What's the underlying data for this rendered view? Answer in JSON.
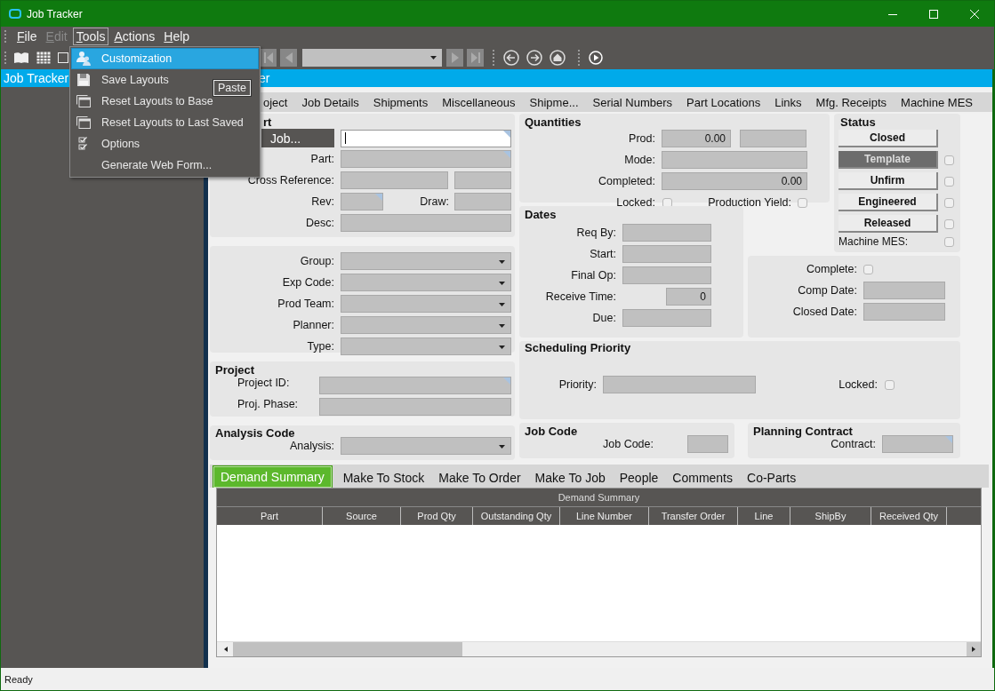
{
  "window": {
    "title": "Job Tracker"
  },
  "menu_bar": [
    {
      "label": "File",
      "disabled": false,
      "selected": false
    },
    {
      "label": "Edit",
      "disabled": true,
      "selected": false
    },
    {
      "label": "Tools",
      "disabled": false,
      "selected": true
    },
    {
      "label": "Actions",
      "disabled": false,
      "selected": false
    },
    {
      "label": "Help",
      "disabled": false,
      "selected": false
    }
  ],
  "open_menu": [
    {
      "label": "Customization",
      "kind": "users",
      "selected": true
    },
    {
      "label": "Save Layouts",
      "kind": "floppy",
      "selected": false
    },
    {
      "label": "Reset Layouts to Base",
      "kind": "window",
      "selected": false
    },
    {
      "label": "Reset Layouts to Last Saved",
      "kind": "window",
      "selected": false
    },
    {
      "label": "Options",
      "kind": "checklist",
      "selected": false
    },
    {
      "label": "Generate Web Form...",
      "kind": "none",
      "selected": false
    }
  ],
  "tooltip": "Paste",
  "left_panel": {
    "title": "Job Tracker"
  },
  "main_header": {
    "title": "er"
  },
  "tabs": [
    {
      "label": "oject",
      "selected": false
    },
    {
      "label": "Job Details",
      "selected": false
    },
    {
      "label": "Shipments",
      "selected": false
    },
    {
      "label": "Miscellaneous",
      "selected": false
    },
    {
      "label": "Shipme...",
      "selected": false
    },
    {
      "label": "Serial Numbers",
      "selected": false
    },
    {
      "label": "Part Locations",
      "selected": false
    },
    {
      "label": "Links",
      "selected": false
    },
    {
      "label": "Mfg. Receipts",
      "selected": false
    },
    {
      "label": "Machine MES",
      "selected": false
    }
  ],
  "part": {
    "title": "rt",
    "rows": [
      {
        "kind": "single",
        "button": "Job...",
        "items": [
          {
            "kind": "field",
            "editable": true,
            "marked": true
          }
        ]
      },
      {
        "kind": "single",
        "label": "Part:",
        "items": [
          {
            "kind": "field",
            "editable": false,
            "marked": true
          }
        ]
      },
      {
        "kind": "pair",
        "label": "Cross Reference:",
        "items": [
          {
            "kind": "field",
            "editable": false,
            "marked": false
          },
          {
            "kind": "field",
            "editable": false,
            "marked": false
          }
        ]
      },
      {
        "kind": "split",
        "label": "Rev:",
        "items": [
          {
            "kind": "field",
            "editable": false,
            "marked": true
          },
          {
            "kind": "label",
            "text": "Draw:"
          },
          {
            "kind": "field",
            "editable": false,
            "marked": false
          }
        ]
      },
      {
        "kind": "single",
        "label": "Desc:",
        "items": [
          {
            "kind": "field",
            "editable": false,
            "marked": false
          }
        ]
      }
    ]
  },
  "classification": {
    "rows": [
      {
        "kind": "single",
        "label": "Group:",
        "items": [
          {
            "kind": "dropdown",
            "editable": false,
            "marked": false
          }
        ]
      },
      {
        "kind": "single",
        "label": "Exp Code:",
        "items": [
          {
            "kind": "dropdown",
            "editable": false,
            "marked": false
          }
        ]
      },
      {
        "kind": "single",
        "label": "Prod Team:",
        "items": [
          {
            "kind": "dropdown",
            "editable": false,
            "marked": false
          }
        ]
      },
      {
        "kind": "single",
        "label": "Planner:",
        "items": [
          {
            "kind": "dropdown",
            "editable": false,
            "marked": false
          }
        ]
      },
      {
        "kind": "single",
        "label": "Type:",
        "items": [
          {
            "kind": "dropdown",
            "editable": false,
            "marked": false
          }
        ]
      }
    ]
  },
  "project": {
    "title": "Project",
    "rows": [
      {
        "kind": "single",
        "label": "Project ID:",
        "items": [
          {
            "kind": "field",
            "editable": false,
            "marked": true
          }
        ]
      },
      {
        "kind": "single",
        "label": "Proj. Phase:",
        "items": [
          {
            "kind": "field",
            "editable": false,
            "marked": false
          }
        ]
      }
    ]
  },
  "analysis": {
    "title": "Analysis Code",
    "rows": [
      {
        "kind": "single",
        "label": "Analysis:",
        "items": [
          {
            "kind": "dropdown",
            "editable": false,
            "marked": false
          }
        ]
      }
    ]
  },
  "quantities": {
    "title": "Quantities",
    "rows": [
      {
        "kind": "pair",
        "label": "Prod:",
        "items": [
          {
            "kind": "field",
            "value": "0.00",
            "editable": false,
            "marked": false
          },
          {
            "kind": "field",
            "editable": false,
            "marked": false
          }
        ]
      },
      {
        "kind": "single",
        "label": "Mode:",
        "items": [
          {
            "kind": "field",
            "editable": false,
            "marked": false
          }
        ]
      },
      {
        "kind": "single",
        "label": "Completed:",
        "items": [
          {
            "kind": "field",
            "value": "0.00",
            "editable": false,
            "marked": false
          }
        ]
      },
      {
        "kind": "split",
        "label": "Locked:",
        "items": [
          {
            "kind": "check",
            "checked": false
          },
          {
            "kind": "label",
            "text": "Production Yield:"
          },
          {
            "kind": "check",
            "checked": false
          }
        ]
      }
    ]
  },
  "dates": {
    "title": "Dates",
    "rows": [
      {
        "kind": "single",
        "label": "Req By:",
        "items": [
          {
            "kind": "field",
            "editable": false,
            "marked": false
          }
        ]
      },
      {
        "kind": "single",
        "label": "Start:",
        "items": [
          {
            "kind": "field",
            "editable": false,
            "marked": false
          }
        ]
      },
      {
        "kind": "single",
        "label": "Final Op:",
        "items": [
          {
            "kind": "field",
            "editable": false,
            "marked": false
          }
        ]
      },
      {
        "kind": "short",
        "label": "Receive Time:",
        "items": [
          {
            "kind": "field",
            "value": "0",
            "editable": false,
            "marked": false
          }
        ]
      },
      {
        "kind": "single",
        "label": "Due:",
        "items": [
          {
            "kind": "field",
            "editable": false,
            "marked": false
          }
        ]
      }
    ]
  },
  "status": {
    "title": "Status",
    "buttons": [
      {
        "label": "Closed",
        "selected": false
      },
      {
        "label": "Template",
        "selected": true,
        "check": {
          "checked": false
        }
      },
      {
        "label": "Unfirm",
        "selected": false,
        "check": {
          "checked": false
        }
      },
      {
        "label": "Engineered",
        "selected": false,
        "check": {
          "checked": false
        }
      },
      {
        "label": "Released",
        "selected": false,
        "check": {
          "checked": false
        }
      }
    ],
    "machine_mes": {
      "label": "Machine MES:",
      "checked": false
    }
  },
  "completion": {
    "rows": [
      {
        "kind": "single",
        "label": "Complete:",
        "items": [
          {
            "kind": "check",
            "checked": false
          }
        ]
      },
      {
        "kind": "single",
        "label": "Comp Date:",
        "items": [
          {
            "kind": "field",
            "editable": false,
            "marked": false
          }
        ]
      },
      {
        "kind": "single",
        "label": "Closed Date:",
        "items": [
          {
            "kind": "field",
            "editable": false,
            "marked": false
          }
        ]
      }
    ]
  },
  "scheduling": {
    "title": "Scheduling Priority",
    "rows": [
      {
        "kind": "split",
        "label": "Priority:",
        "items": [
          {
            "kind": "field",
            "editable": false,
            "marked": false
          },
          {
            "kind": "label",
            "text": "Locked:"
          },
          {
            "kind": "check",
            "checked": false
          }
        ]
      }
    ]
  },
  "job_code": {
    "title": "Job Code",
    "rows": [
      {
        "kind": "offset",
        "label": "Job Code:",
        "items": [
          {
            "kind": "field",
            "editable": false,
            "marked": false
          }
        ]
      }
    ]
  },
  "planning_contract": {
    "title": "Planning Contract",
    "rows": [
      {
        "kind": "single",
        "label": "Contract:",
        "items": [
          {
            "kind": "field",
            "editable": false,
            "marked": true
          }
        ]
      }
    ]
  },
  "bottom_tabs": [
    {
      "label": "Demand Summary",
      "selected": true
    },
    {
      "label": "Make To Stock",
      "selected": false
    },
    {
      "label": "Make To Order",
      "selected": false
    },
    {
      "label": "Make To Job",
      "selected": false
    },
    {
      "label": "People",
      "selected": false
    },
    {
      "label": "Comments",
      "selected": false
    },
    {
      "label": "Co-Parts",
      "selected": false
    }
  ],
  "grid": {
    "title": "Demand Summary",
    "columns": [
      "Part",
      "Source",
      "Prod Qty",
      "Outstanding Qty",
      "Line Number",
      "Transfer Order",
      "Line",
      "ShipBy",
      "Received Qty"
    ]
  },
  "status_bar": "Ready"
}
